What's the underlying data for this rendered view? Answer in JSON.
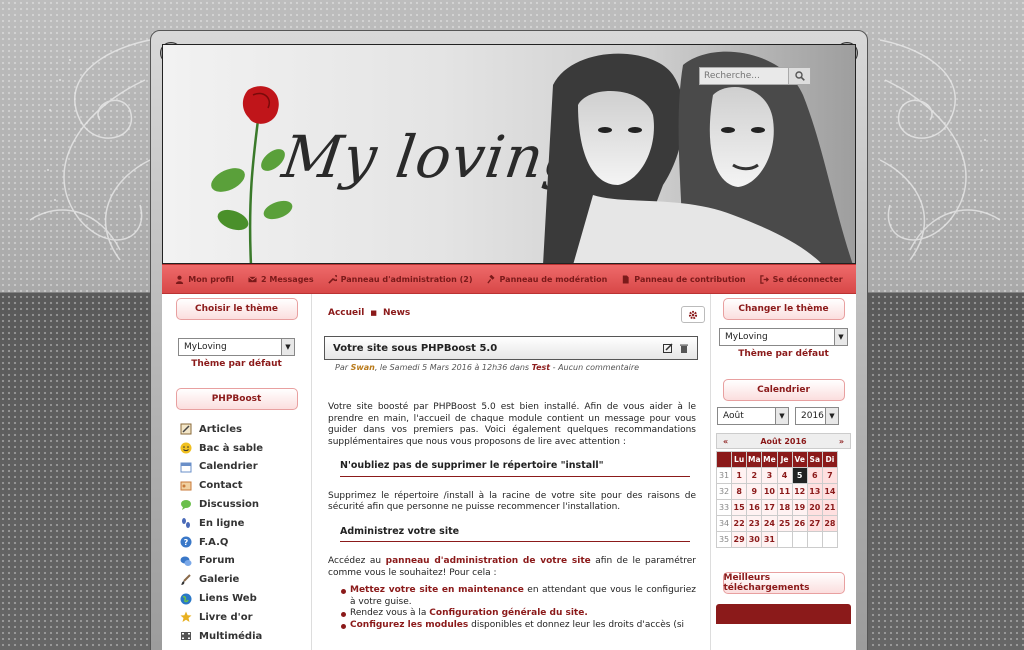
{
  "header": {
    "logo": "My loving",
    "search_placeholder": "Recherche..."
  },
  "userbar": [
    {
      "label": "Mon profil",
      "icon": "user-icon"
    },
    {
      "label": "2 Messages",
      "icon": "envelope-icon"
    },
    {
      "label": "Panneau d'administration (2)",
      "icon": "wrench-icon"
    },
    {
      "label": "Panneau de modération",
      "icon": "gavel-icon"
    },
    {
      "label": "Panneau de contribution",
      "icon": "file-icon"
    },
    {
      "label": "Se déconnecter",
      "icon": "logout-icon"
    }
  ],
  "left": {
    "theme_title": "Choisir le thème",
    "theme_value": "MyLoving",
    "default_theme": "Thème par défaut",
    "menu_title": "PHPBoost",
    "items": [
      {
        "label": "Articles",
        "icon": "edit-icon",
        "color": "#c8a060"
      },
      {
        "label": "Bac à sable",
        "icon": "smiley-icon",
        "color": "#f0c020"
      },
      {
        "label": "Calendrier",
        "icon": "calendar-icon",
        "color": "#6a8fc8"
      },
      {
        "label": "Contact",
        "icon": "contact-icon",
        "color": "#c87a3a"
      },
      {
        "label": "Discussion",
        "icon": "chat-icon",
        "color": "#4a9a4a"
      },
      {
        "label": "En ligne",
        "icon": "footprints-icon",
        "color": "#4a6ab8"
      },
      {
        "label": "F.A.Q",
        "icon": "help-icon",
        "color": "#3a78c8"
      },
      {
        "label": "Forum",
        "icon": "forum-icon",
        "color": "#3a78c8"
      },
      {
        "label": "Galerie",
        "icon": "brush-icon",
        "color": "#8a6a4a"
      },
      {
        "label": "Liens Web",
        "icon": "globe-icon",
        "color": "#2a78c8"
      },
      {
        "label": "Livre d'or",
        "icon": "star-icon",
        "color": "#e8b020"
      },
      {
        "label": "Multimédia",
        "icon": "film-icon",
        "color": "#555555"
      }
    ]
  },
  "center": {
    "breadcrumb": [
      "Accueil",
      "News"
    ],
    "article_title": "Votre site sous PHPBoost 5.0",
    "meta_by": "Par",
    "meta_author": "Swan",
    "meta_date": ", le Samedi 5 Mars 2016 à 12h36 dans",
    "meta_cat": "Test",
    "meta_comments": "- Aucun commentaire",
    "intro": "Votre site boosté par PHPBoost 5.0 est bien installé. Afin de vous aider à le prendre en main, l'accueil de chaque module contient un message pour vous guider dans vos premiers pas. Voici également quelques recommandations supplémentaires que nous vous proposons de lire avec attention :",
    "h_install": "N'oubliez pas de supprimer le répertoire \"install\"",
    "p_install": "Supprimez le répertoire /install à la racine de votre site pour des raisons de sécurité afin que personne ne puisse recommencer l'installation.",
    "h_admin": "Administrez votre site",
    "p_admin_pre": "Accédez au",
    "p_admin_link": "panneau d'administration de votre site",
    "p_admin_post": "afin de le paramétrer comme vous le souhaitez! Pour cela :",
    "li1_link": "Mettez votre site en maintenance",
    "li1_text": "en attendant que vous le configuriez à votre guise.",
    "li2_text": "Rendez vous à la",
    "li2_link": "Configuration générale du site.",
    "li3_link": "Configurez les modules",
    "li3_text": "disponibles et donnez leur les droits d'accès (si"
  },
  "right": {
    "theme_title": "Changer le thème",
    "theme_value": "MyLoving",
    "default_theme": "Thème par défaut",
    "cal_title": "Calendrier",
    "month_select": "Août",
    "year_select": "2016",
    "month_label": "Août 2016",
    "prev": "«",
    "next": "»",
    "days": [
      "Lu",
      "Ma",
      "Me",
      "Je",
      "Ve",
      "Sa",
      "Di"
    ],
    "weeks": [
      {
        "wk": "31",
        "d": [
          "1",
          "2",
          "3",
          "4",
          "5",
          "6",
          "7"
        ]
      },
      {
        "wk": "32",
        "d": [
          "8",
          "9",
          "10",
          "11",
          "12",
          "13",
          "14"
        ]
      },
      {
        "wk": "33",
        "d": [
          "15",
          "16",
          "17",
          "18",
          "19",
          "20",
          "21"
        ]
      },
      {
        "wk": "34",
        "d": [
          "22",
          "23",
          "24",
          "25",
          "26",
          "27",
          "28"
        ]
      },
      {
        "wk": "35",
        "d": [
          "29",
          "30",
          "31",
          "",
          "",
          "",
          ""
        ]
      }
    ],
    "today": "5",
    "downloads_title": "Meilleurs téléchargements"
  }
}
